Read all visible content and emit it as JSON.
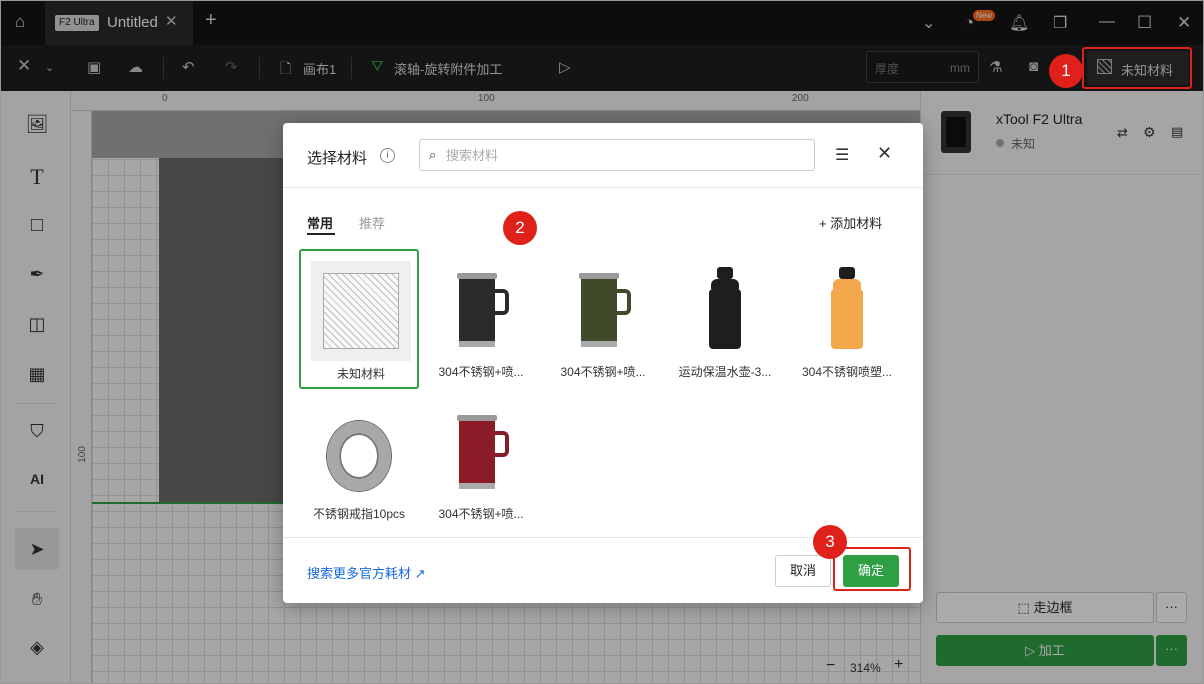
{
  "titlebar": {
    "device_tag": "F2 Ultra",
    "tab_title": "Untitled",
    "new_badge": "New"
  },
  "toolbar": {
    "canvas_label": "画布1",
    "mode_label": "滚轴-旋转附件加工",
    "thickness_placeholder": "厚度",
    "thickness_unit": "mm",
    "material_button": "未知材料"
  },
  "canvas": {
    "ruler_top": [
      "0",
      "100",
      "200"
    ],
    "ruler_left": [
      "100"
    ],
    "zoom": "314%"
  },
  "device": {
    "name": "xTool F2 Ultra",
    "status": "未知"
  },
  "right_panel": {
    "frame_button": "走边框",
    "run_button": "加工"
  },
  "dialog": {
    "title": "选择材料",
    "search_placeholder": "搜索材料",
    "tabs": [
      "常用",
      "推荐"
    ],
    "add_material": "添加材料",
    "materials": [
      {
        "label": "未知材料",
        "kind": "unknown"
      },
      {
        "label": "304不锈钢+喷...",
        "kind": "mug",
        "color": "#2b2b2b"
      },
      {
        "label": "304不锈钢+喷...",
        "kind": "mug",
        "color": "#3f4a2a"
      },
      {
        "label": "运动保温水壶-3...",
        "kind": "bottle",
        "color": "#1e1e1e"
      },
      {
        "label": "304不锈钢喷塑...",
        "kind": "bottle",
        "color": "#f4a64a"
      },
      {
        "label": "不锈钢戒指10pcs",
        "kind": "ring"
      },
      {
        "label": "304不锈钢+喷...",
        "kind": "mug",
        "color": "#8a1c2a"
      }
    ],
    "more_link": "搜索更多官方耗材 ↗",
    "cancel": "取消",
    "ok": "确定"
  },
  "callouts": [
    "1",
    "2",
    "3"
  ]
}
